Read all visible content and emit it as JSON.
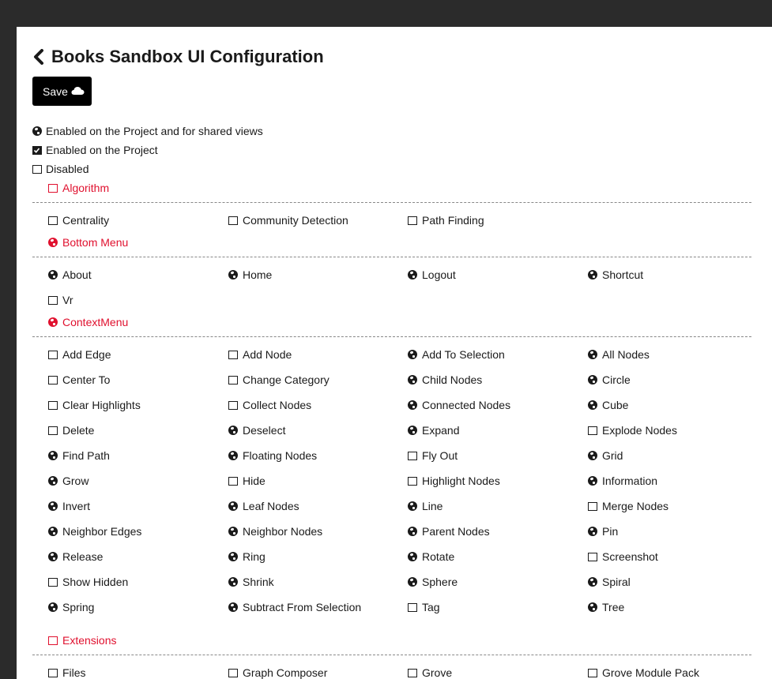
{
  "page": {
    "title": "Books Sandbox UI Configuration",
    "save_label": "Save"
  },
  "legend": [
    {
      "icon": "globe-icon",
      "text": "Enabled on the Project and for shared views"
    },
    {
      "icon": "checked-box-icon",
      "text": "Enabled on the Project"
    },
    {
      "icon": "empty-box-icon",
      "text": "Disabled"
    }
  ],
  "colors": {
    "accent": "#e0102e",
    "button_bg": "#000000",
    "frame": "#2b2b2b"
  },
  "sections": [
    {
      "title": "Algorithm",
      "state": "disabled",
      "items": [
        {
          "label": "Centrality",
          "state": "disabled"
        },
        {
          "label": "Community Detection",
          "state": "disabled"
        },
        {
          "label": "Path Finding",
          "state": "disabled"
        }
      ]
    },
    {
      "title": "Bottom Menu",
      "state": "shared",
      "items": [
        {
          "label": "About",
          "state": "shared"
        },
        {
          "label": "Home",
          "state": "shared"
        },
        {
          "label": "Logout",
          "state": "shared"
        },
        {
          "label": "Shortcut",
          "state": "shared"
        },
        {
          "label": "Vr",
          "state": "disabled"
        }
      ]
    },
    {
      "title": "ContextMenu",
      "state": "shared",
      "items": [
        {
          "label": "Add Edge",
          "state": "disabled"
        },
        {
          "label": "Add Node",
          "state": "disabled"
        },
        {
          "label": "Add To Selection",
          "state": "shared"
        },
        {
          "label": "All Nodes",
          "state": "shared"
        },
        {
          "label": "Center To",
          "state": "disabled"
        },
        {
          "label": "Change Category",
          "state": "disabled"
        },
        {
          "label": "Child Nodes",
          "state": "shared"
        },
        {
          "label": "Circle",
          "state": "shared"
        },
        {
          "label": "Clear Highlights",
          "state": "disabled"
        },
        {
          "label": "Collect Nodes",
          "state": "disabled"
        },
        {
          "label": "Connected Nodes",
          "state": "shared"
        },
        {
          "label": "Cube",
          "state": "shared"
        },
        {
          "label": "Delete",
          "state": "disabled"
        },
        {
          "label": "Deselect",
          "state": "shared"
        },
        {
          "label": "Expand",
          "state": "shared"
        },
        {
          "label": "Explode Nodes",
          "state": "disabled"
        },
        {
          "label": "Find Path",
          "state": "shared"
        },
        {
          "label": "Floating Nodes",
          "state": "shared"
        },
        {
          "label": "Fly Out",
          "state": "disabled"
        },
        {
          "label": "Grid",
          "state": "shared"
        },
        {
          "label": "Grow",
          "state": "shared"
        },
        {
          "label": "Hide",
          "state": "disabled"
        },
        {
          "label": "Highlight Nodes",
          "state": "disabled"
        },
        {
          "label": "Information",
          "state": "shared"
        },
        {
          "label": "Invert",
          "state": "shared"
        },
        {
          "label": "Leaf Nodes",
          "state": "shared"
        },
        {
          "label": "Line",
          "state": "shared"
        },
        {
          "label": "Merge Nodes",
          "state": "disabled"
        },
        {
          "label": "Neighbor Edges",
          "state": "shared"
        },
        {
          "label": "Neighbor Nodes",
          "state": "shared"
        },
        {
          "label": "Parent Nodes",
          "state": "shared"
        },
        {
          "label": "Pin",
          "state": "shared"
        },
        {
          "label": "Release",
          "state": "shared"
        },
        {
          "label": "Ring",
          "state": "shared"
        },
        {
          "label": "Rotate",
          "state": "shared"
        },
        {
          "label": "Screenshot",
          "state": "disabled"
        },
        {
          "label": "Show Hidden",
          "state": "disabled"
        },
        {
          "label": "Shrink",
          "state": "shared"
        },
        {
          "label": "Sphere",
          "state": "shared"
        },
        {
          "label": "Spiral",
          "state": "shared"
        },
        {
          "label": "Spring",
          "state": "shared"
        },
        {
          "label": "Subtract From Selection",
          "state": "shared"
        },
        {
          "label": "Tag",
          "state": "disabled"
        },
        {
          "label": "Tree",
          "state": "shared"
        }
      ]
    },
    {
      "title": "Extensions",
      "state": "disabled",
      "items": [
        {
          "label": "Files",
          "state": "disabled"
        },
        {
          "label": "Graph Composer",
          "state": "disabled"
        },
        {
          "label": "Grove",
          "state": "disabled"
        },
        {
          "label": "Grove Module Pack",
          "state": "disabled"
        }
      ]
    }
  ]
}
